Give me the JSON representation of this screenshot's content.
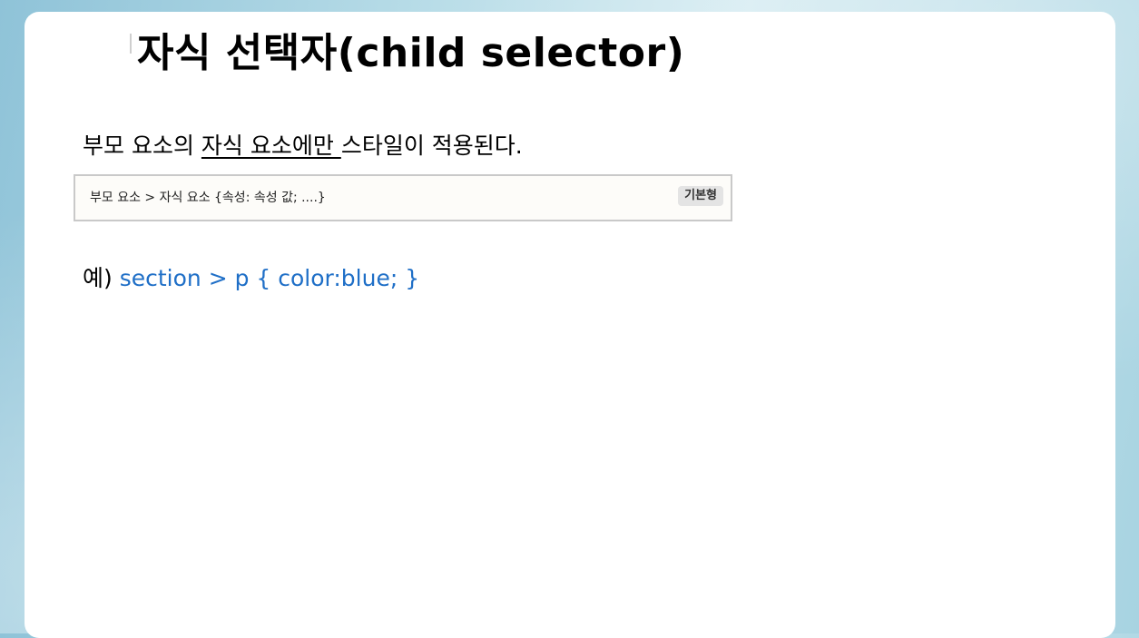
{
  "slide": {
    "title": "자식 선택자(child selector)",
    "description": {
      "before": "부모 요소의 ",
      "underlined": "자식 요소에만 ",
      "after": "스타일이 적용된다."
    },
    "syntax_box": {
      "text": "부모 요소  >  자식 요소  {속성: 속성 값;  ....}",
      "badge": "기본형"
    },
    "example": {
      "prefix": "예) ",
      "code": "section > p { color:blue; }",
      "code_color": "#1f6fc7"
    }
  }
}
